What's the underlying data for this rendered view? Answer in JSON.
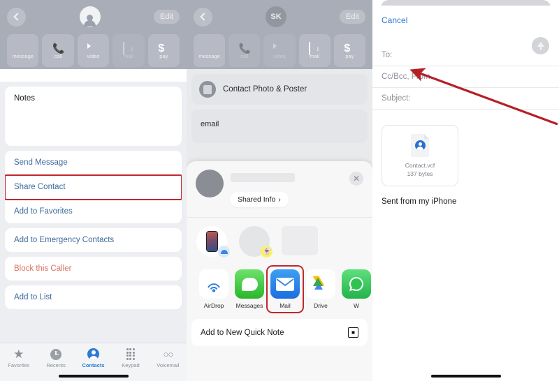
{
  "left_panel": {
    "header": {
      "back_icon": "chevron-left-icon",
      "avatar_icon": "person-avatar-icon",
      "edit_label": "Edit"
    },
    "actions": [
      {
        "label": "message",
        "icon": "message-bubble-icon",
        "dim": false
      },
      {
        "label": "call",
        "icon": "phone-icon",
        "dim": false
      },
      {
        "label": "video",
        "icon": "video-camera-icon",
        "dim": false
      },
      {
        "label": "mail",
        "icon": "envelope-icon",
        "dim": true
      },
      {
        "label": "pay",
        "icon": "dollar-icon",
        "dim": false
      }
    ],
    "notes_label": "Notes",
    "group1": [
      {
        "label": "Send Message",
        "style": "link",
        "highlighted": false
      },
      {
        "label": "Share Contact",
        "style": "link",
        "highlighted": true
      },
      {
        "label": "Add to Favorites",
        "style": "link",
        "highlighted": false
      }
    ],
    "group2": [
      {
        "label": "Add to Emergency Contacts",
        "style": "link",
        "highlighted": false
      }
    ],
    "group3": [
      {
        "label": "Block this Caller",
        "style": "danger",
        "highlighted": false
      }
    ],
    "group4": [
      {
        "label": "Add to List",
        "style": "link",
        "highlighted": false
      }
    ],
    "tabs": [
      {
        "label": "Favorites",
        "icon": "star-icon",
        "active": false
      },
      {
        "label": "Recents",
        "icon": "clock-icon",
        "active": false
      },
      {
        "label": "Contacts",
        "icon": "person-icon",
        "active": true
      },
      {
        "label": "Keypad",
        "icon": "keypad-icon",
        "active": false
      },
      {
        "label": "Voicemail",
        "icon": "voicemail-icon",
        "active": false
      }
    ]
  },
  "mid_panel": {
    "header": {
      "back_icon": "chevron-left-icon",
      "avatar_initials": "SK",
      "edit_label": "Edit"
    },
    "actions": [
      {
        "label": "message",
        "icon": "message-bubble-icon",
        "dim": false
      },
      {
        "label": "call",
        "icon": "phone-icon",
        "dim": true
      },
      {
        "label": "video",
        "icon": "video-camera-icon",
        "dim": true
      },
      {
        "label": "mail",
        "icon": "envelope-icon",
        "dim": false
      },
      {
        "label": "pay",
        "icon": "dollar-icon",
        "dim": false
      }
    ],
    "photo_poster_label": "Contact Photo & Poster",
    "email_label": "email",
    "share_sheet": {
      "close_icon": "close-icon",
      "shared_info_label": "Shared Info",
      "shared_info_chevron": "›",
      "suggestions": [
        {
          "name": "airdrop-suggestion",
          "badge": "airdrop-icon"
        },
        {
          "name": "snapchat-suggestion",
          "badge": "snapchat-ghost-icon"
        },
        {
          "name": "placeholder-suggestion",
          "badge": ""
        }
      ],
      "apps": [
        {
          "label": "AirDrop",
          "icon": "airdrop-icon",
          "highlighted": false
        },
        {
          "label": "Messages",
          "icon": "messages-icon",
          "highlighted": false
        },
        {
          "label": "Mail",
          "icon": "mail-icon",
          "highlighted": true
        },
        {
          "label": "Drive",
          "icon": "google-drive-icon",
          "highlighted": false
        },
        {
          "label": "W",
          "icon": "whatsapp-icon",
          "highlighted": false
        }
      ],
      "quick_note_label": "Add to New Quick Note",
      "quick_note_icon": "note-icon"
    }
  },
  "right_panel": {
    "cancel_label": "Cancel",
    "send_icon": "send-up-arrow-icon",
    "fields": [
      {
        "label": "To:",
        "value": ""
      },
      {
        "label": "Cc/Bcc, From",
        "value": ""
      },
      {
        "label": "Subject:",
        "value": ""
      }
    ],
    "attachment": {
      "icon": "vcf-contact-file-icon",
      "filename": "Contact.vcf",
      "filesize": "137 bytes"
    },
    "signature": "Sent from my iPhone",
    "annotation": {
      "name": "red-arrow-annotation",
      "color": "#b52026",
      "points_at": "To:"
    }
  },
  "colors": {
    "highlight_red": "#c0282d",
    "link_blue": "#3e6b9e",
    "accent_blue": "#2b7bd4",
    "danger": "#d9725f"
  }
}
